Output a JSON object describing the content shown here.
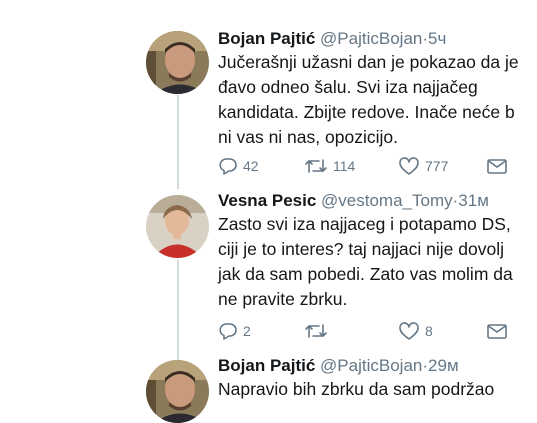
{
  "tweets": [
    {
      "name": "Bojan Pajtić",
      "handle": "@PajticBojan",
      "sep": "·",
      "time": "5ч",
      "lines": [
        "Jučerašnji užasni dan je pokazao da je",
        "đavo odneo šalu. Svi iza najjačeg",
        "kandidata. Zbijte redove. Inače neće b",
        "ni vas ni nas, opozicijo."
      ],
      "replies": "42",
      "retweets": "114",
      "likes": "777"
    },
    {
      "name": "Vesna Pesic",
      "handle": "@vestoma_Tomy",
      "sep": "·",
      "time": "31м",
      "lines": [
        "Zasto svi iza najjaceg i potapamo DS,",
        "ciji je to interes?  taj najjaci nije dovolj",
        "jak da sam pobedi. Zato vas molim da",
        "ne pravite zbrku."
      ],
      "replies": "2",
      "retweets": "",
      "likes": "8"
    },
    {
      "name": "Bojan Pajtić",
      "handle": "@PajticBojan",
      "sep": "·",
      "time": "29м",
      "lines": [
        "Napravio bih zbrku da sam podržao"
      ]
    }
  ],
  "icons": {
    "reply": "reply-icon",
    "retweet": "retweet-icon",
    "like": "heart-icon",
    "dm": "mail-icon"
  },
  "colors": {
    "text": "#14171a",
    "muted": "#657786",
    "thread_line": "#cfd9de"
  }
}
